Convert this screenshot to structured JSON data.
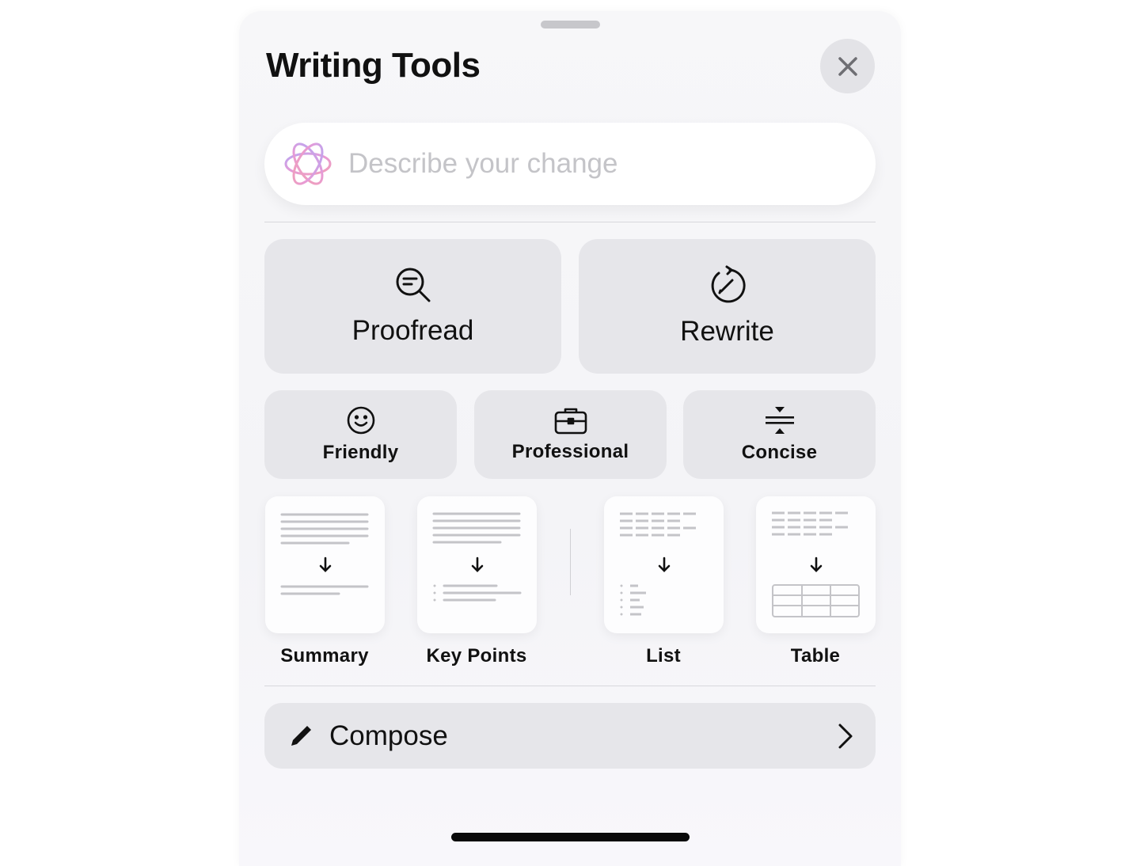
{
  "header": {
    "title": "Writing Tools",
    "close_icon": "xmark-icon"
  },
  "prompt": {
    "placeholder": "Describe your change",
    "value": "",
    "icon": "apple-intelligence-icon"
  },
  "primary_actions": [
    {
      "label": "Proofread",
      "icon": "magnifier-text-icon"
    },
    {
      "label": "Rewrite",
      "icon": "rewrite-circle-icon"
    }
  ],
  "tone_actions": [
    {
      "label": "Friendly",
      "icon": "smiley-icon"
    },
    {
      "label": "Professional",
      "icon": "briefcase-icon"
    },
    {
      "label": "Concise",
      "icon": "compress-icon"
    }
  ],
  "format_actions": [
    {
      "label": "Summary"
    },
    {
      "label": "Key Points"
    },
    {
      "label": "List"
    },
    {
      "label": "Table"
    }
  ],
  "compose": {
    "label": "Compose",
    "icon": "pencil-icon",
    "chevron": "chevron-right-icon"
  }
}
